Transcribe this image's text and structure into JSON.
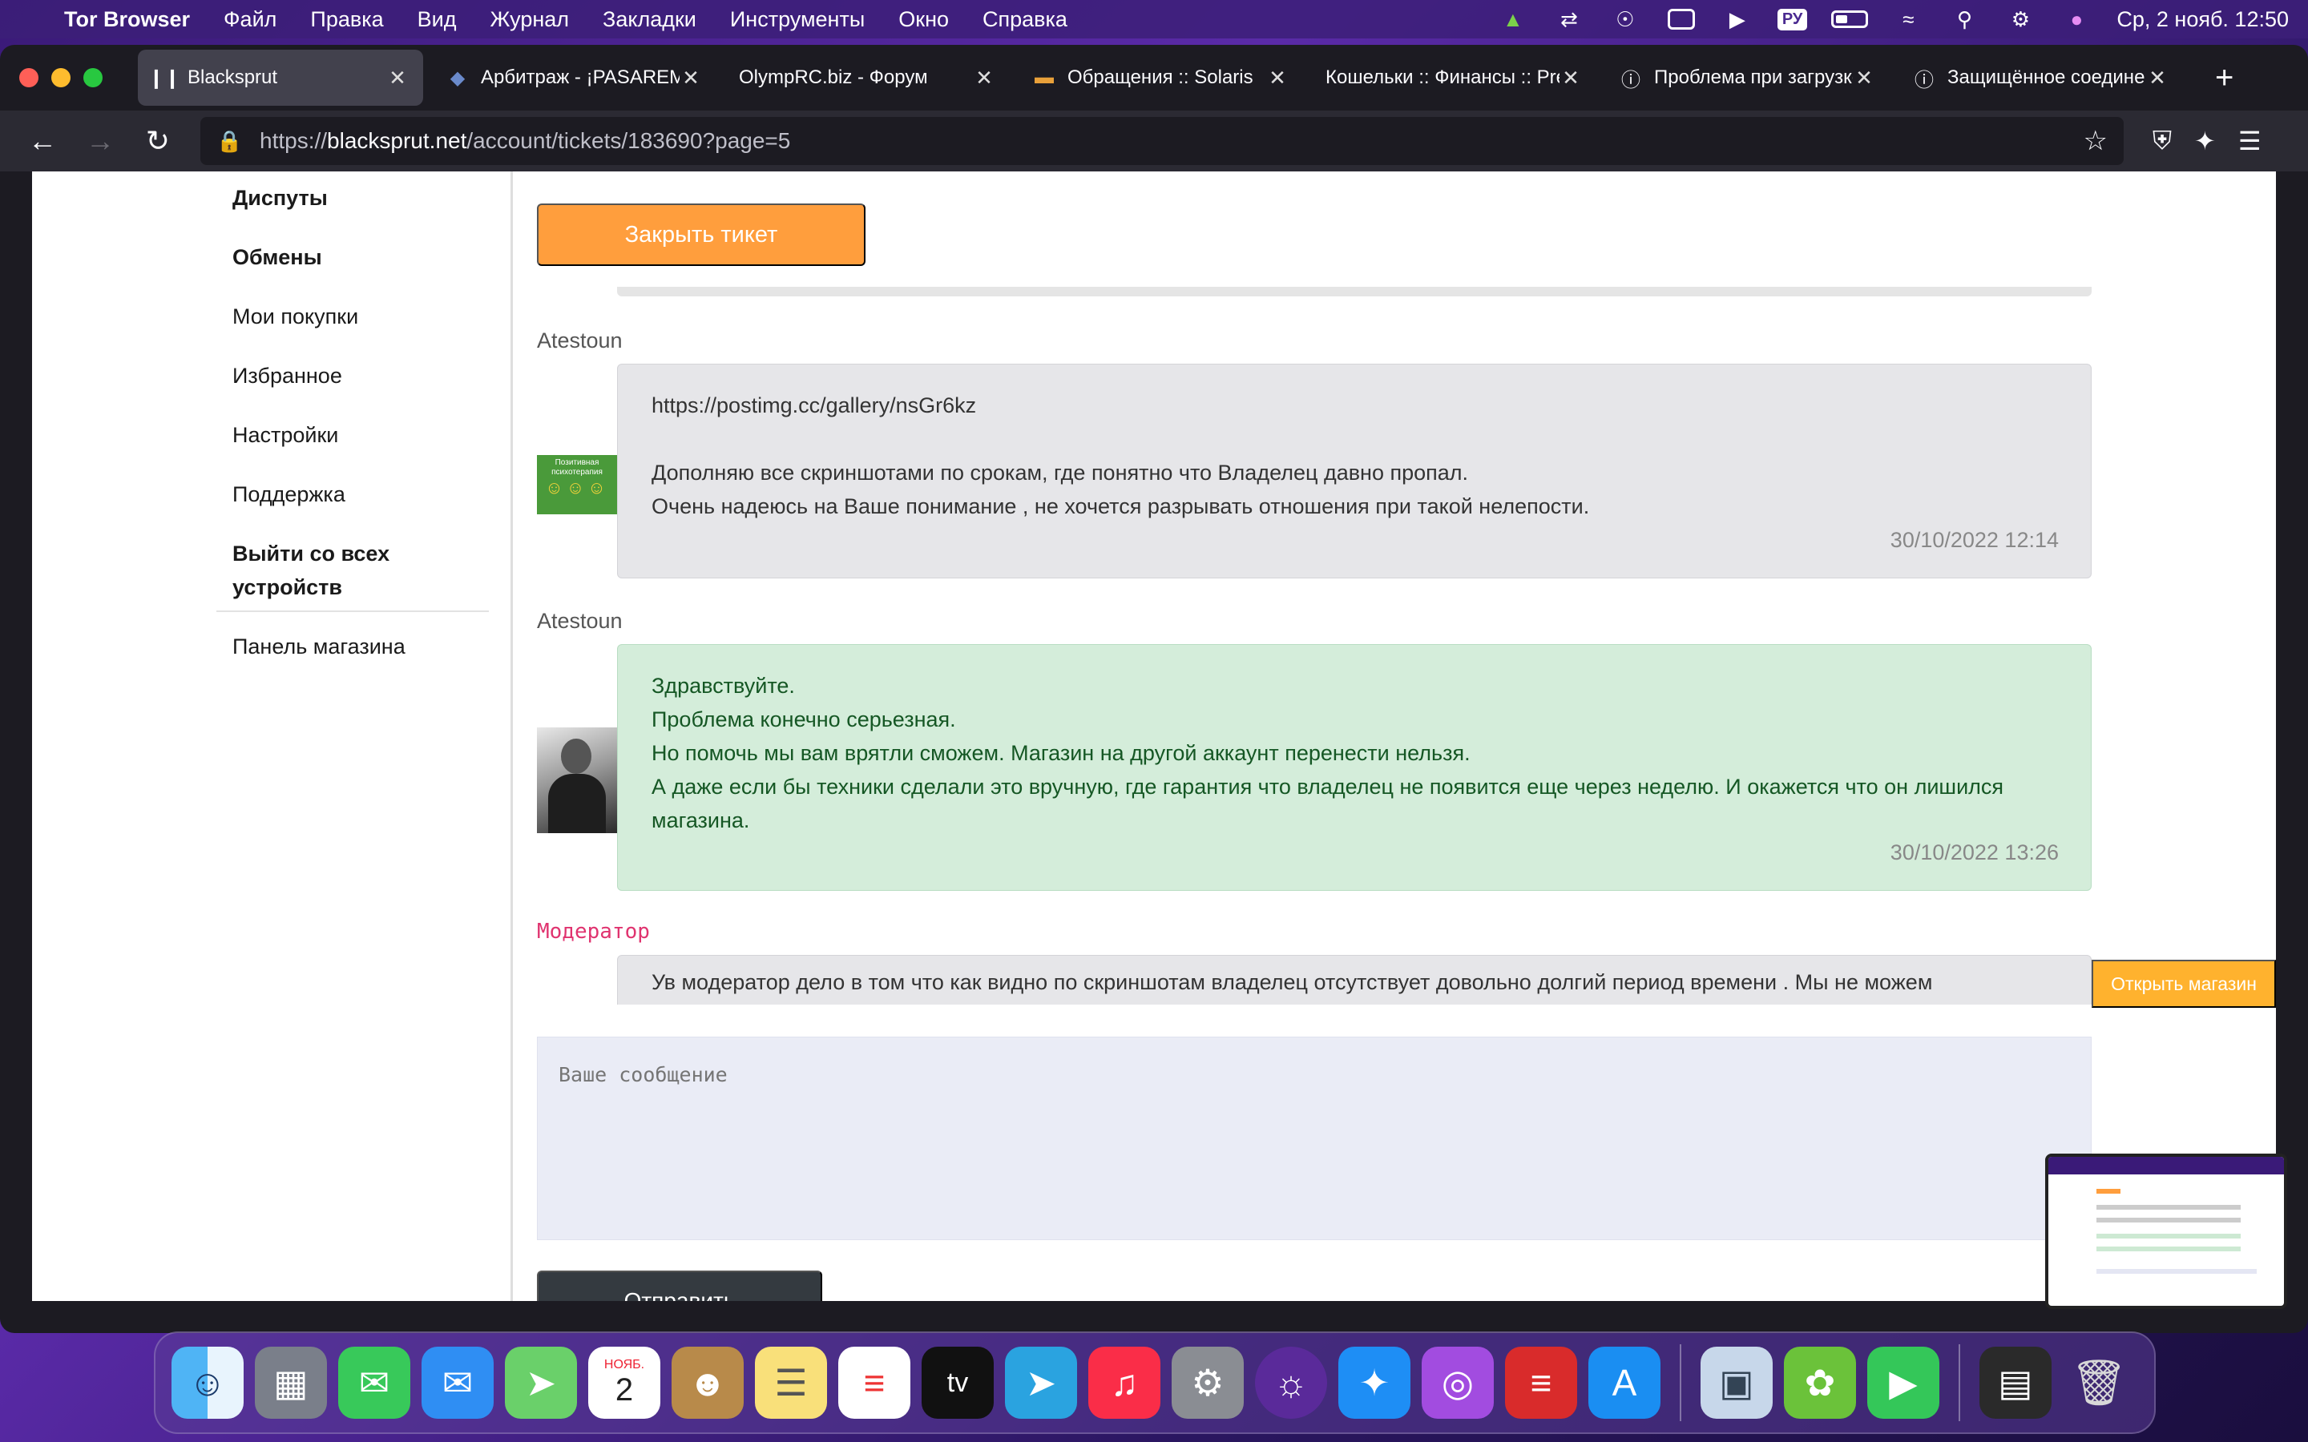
{
  "menubar": {
    "app_name": "Tor Browser",
    "items": [
      "Файл",
      "Правка",
      "Вид",
      "Журнал",
      "Закладки",
      "Инструменты",
      "Окно",
      "Справка"
    ],
    "lang": "РУ",
    "datetime": "Ср, 2 нояб.  12:50"
  },
  "tabs": [
    {
      "title": "Blacksprut",
      "icon": "blacksprut-icon"
    },
    {
      "title": "Арбитраж - ¡PASAREMOS!",
      "icon": "diamond-icon"
    },
    {
      "title": "OlympRC.biz - Форум",
      "icon": "none"
    },
    {
      "title": "Обращения :: Solaris",
      "icon": "burger-icon"
    },
    {
      "title": "Кошельки :: Финансы :: Pre",
      "icon": "none"
    },
    {
      "title": "Проблема при загрузке",
      "icon": "info-icon"
    },
    {
      "title": "Защищённое соединение",
      "icon": "info-icon"
    }
  ],
  "url": {
    "scheme": "https://",
    "host": "blacksprut.net",
    "path": "/account/tickets/183690?page=5"
  },
  "sidebar": {
    "items": [
      {
        "label": "Диспуты",
        "bold": true
      },
      {
        "label": "Обмены",
        "bold": true
      },
      {
        "label": "Мои покупки",
        "bold": false
      },
      {
        "label": "Избранное",
        "bold": false
      },
      {
        "label": "Настройки",
        "bold": false
      },
      {
        "label": "Поддержка",
        "bold": false
      },
      {
        "label": "Выйти со всех",
        "bold": true
      },
      {
        "label": "устройств",
        "bold": true
      }
    ],
    "shop_panel": "Панель магазина"
  },
  "ticket": {
    "close_button": "Закрыть тикет",
    "messages": [
      {
        "author": "Atestoun",
        "lines": [
          "https://postimg.cc/gallery/nsGr6kz",
          "",
          "Дополняю все скриншотами по срокам, где понятно что Владелец давно пропал.",
          "Очень надеюсь на Ваше понимание , не хочется разрывать отношения при такой нелепости."
        ],
        "time": "30/10/2022 12:14",
        "avatar_text": [
          "Позитивная",
          "психотерапия"
        ]
      },
      {
        "author": "Atestoun",
        "lines": [
          "Здравствуйте.",
          "Проблема конечно серьезная.",
          "Но помочь мы вам врятли сможем. Магазин на другой аккаунт перенести нельзя.",
          "А даже если бы техники сделали это вручную, где гарантия что владелец не появится еще через неделю. И окажется что он лишился",
          "магазина."
        ],
        "time": "30/10/2022 13:26"
      },
      {
        "author": "Модератор",
        "lines": [
          "Ув модератор дело в том что как видно по скриншотам владелец отсутствует довольно долгий период времени . Мы не можем"
        ]
      }
    ],
    "open_shop": "Открыть магазин",
    "message_placeholder": "Ваше сообщение",
    "send_button": "Отправить"
  },
  "dock": {
    "calendar_month": "НОЯБ.",
    "calendar_day": "2",
    "tv_label": "tv"
  },
  "colors": {
    "accent_orange": "#ff9e3d",
    "open_shop": "#ffb22e",
    "moderator": "#e0336f",
    "green_bubble": "#d4edda",
    "green_text": "#155724"
  }
}
